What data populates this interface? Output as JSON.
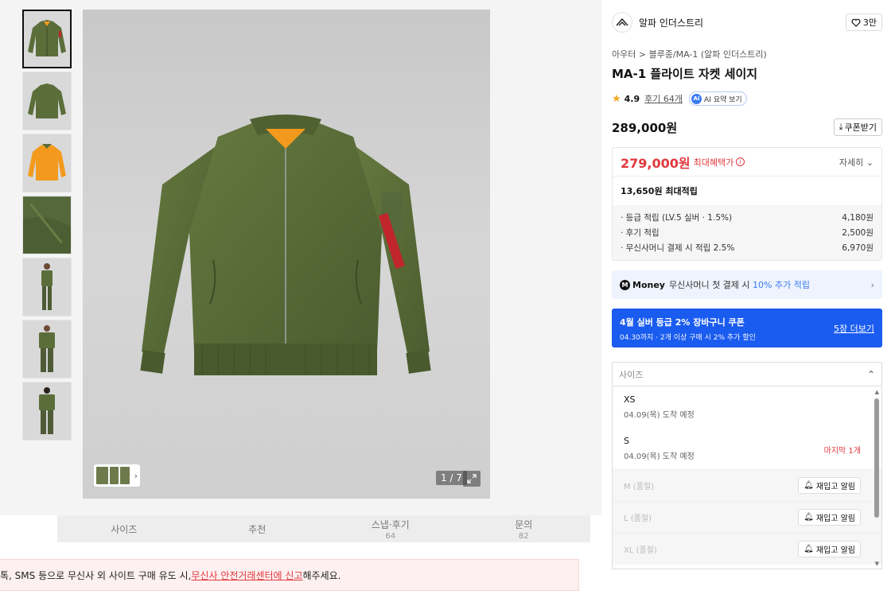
{
  "gallery": {
    "thumbnail_count": 7,
    "counter": "1 / 7"
  },
  "tabs": [
    {
      "label": "사이즈",
      "count": ""
    },
    {
      "label": "추천",
      "count": ""
    },
    {
      "label": "스냅·후기",
      "count": "64"
    },
    {
      "label": "문의",
      "count": "82"
    }
  ],
  "notice": {
    "prefix": "톡, SMS 등으로 무신사 외 사이트 구매 유도 시, ",
    "link": "무신사 안전거래센터에 신고",
    "suffix": " 해주세요."
  },
  "product": {
    "brand": "알파 인더스트리",
    "likes": "3만",
    "breadcrumb": "아우터 > 블루종/MA-1 (알파 인더스트리)",
    "title": "MA-1 플라이트 자켓 세이지",
    "rating": "4.9",
    "reviews": "후기 64개",
    "ai_summary": "AI 요약 보기",
    "price": "289,000원",
    "coupon_button": "쿠폰받기"
  },
  "benefits": {
    "max_price": "279,000원",
    "max_label": "최대혜택가",
    "detail": "자세히",
    "points_title": "13,650원 최대적립",
    "points": [
      {
        "label": "· 등급 적립 (LV.5 실버 · 1.5%)",
        "value": "4,180원"
      },
      {
        "label": "· 후기 적립",
        "value": "2,500원"
      },
      {
        "label": "· 무신사머니 결제 시 적립 2.5%",
        "value": "6,970원"
      }
    ]
  },
  "money_promo": {
    "brand": "Money",
    "text_before": "무신사머니 첫 결제 시 ",
    "pct": "10% 추가 적립"
  },
  "coupon_banner": {
    "title": "4월 실버 등급 2% 장바구니 쿠폰",
    "subtitle": "04.30까지 · 2개 이상 구매 시 2% 추가 할인",
    "more": "5장 더보기"
  },
  "size_select": {
    "placeholder": "사이즈",
    "options": [
      {
        "name": "XS",
        "date": "04.09(목) 도착 예정",
        "note": ""
      },
      {
        "name": "S",
        "date": "04.09(목) 도착 예정",
        "note": "마지막 1개"
      }
    ],
    "soldout": [
      {
        "name": "M (품절)",
        "button": "재입고 알림"
      },
      {
        "name": "L (품절)",
        "button": "재입고 알림"
      },
      {
        "name": "XL (품절)",
        "button": "재입고 알림"
      }
    ]
  },
  "colors": {
    "sale": "#e0383e",
    "accent_blue": "#1a5cf0",
    "jacket_green": "#5b6e3a",
    "lining_orange": "#f39a1e"
  }
}
